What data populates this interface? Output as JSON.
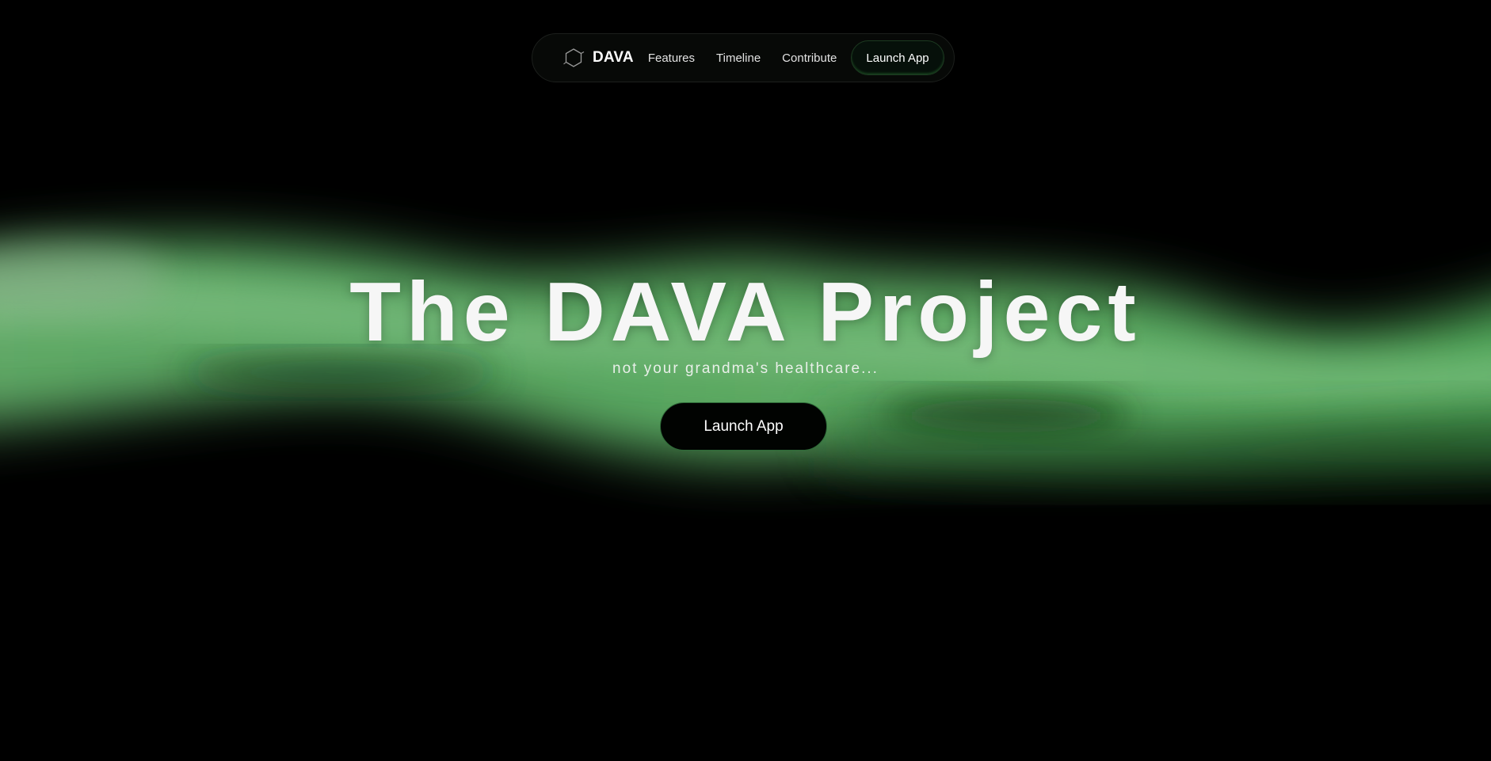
{
  "nav": {
    "logo_icon": "hexagon-logo-icon",
    "brand": "DAVA",
    "links": [
      "Features",
      "Timeline",
      "Contribute"
    ],
    "cta_label": "Launch App"
  },
  "hero": {
    "title": "The DAVA Project",
    "subtitle": "not your grandma's healthcare...",
    "cta_label": "Launch App"
  },
  "colors": {
    "background": "#000000",
    "accent_green": "#4faa5c",
    "text": "#ffffff"
  }
}
